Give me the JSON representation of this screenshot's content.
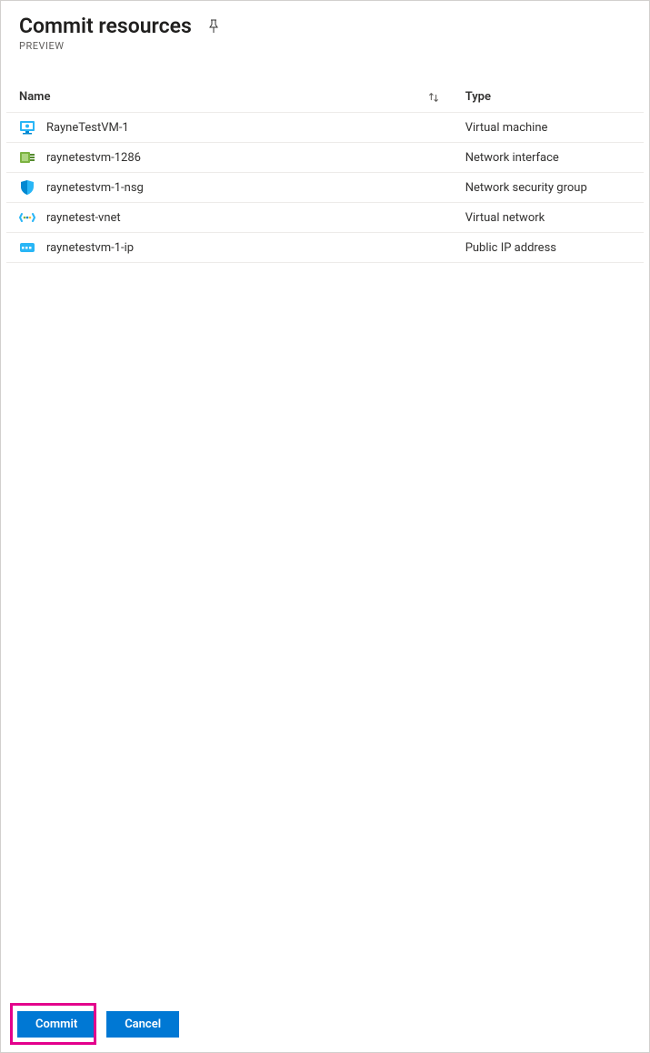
{
  "header": {
    "title": "Commit resources",
    "subtitle": "PREVIEW"
  },
  "columns": {
    "name": "Name",
    "type": "Type"
  },
  "rows": [
    {
      "icon": "vm",
      "name": "RayneTestVM-1",
      "type": "Virtual machine"
    },
    {
      "icon": "nic",
      "name": "raynetestvm-1286",
      "type": "Network interface"
    },
    {
      "icon": "nsg",
      "name": "raynetestvm-1-nsg",
      "type": "Network security group"
    },
    {
      "icon": "vnet",
      "name": "raynetest-vnet",
      "type": "Virtual network"
    },
    {
      "icon": "publicip",
      "name": "raynetestvm-1-ip",
      "type": "Public IP address"
    }
  ],
  "footer": {
    "commit": "Commit",
    "cancel": "Cancel"
  }
}
